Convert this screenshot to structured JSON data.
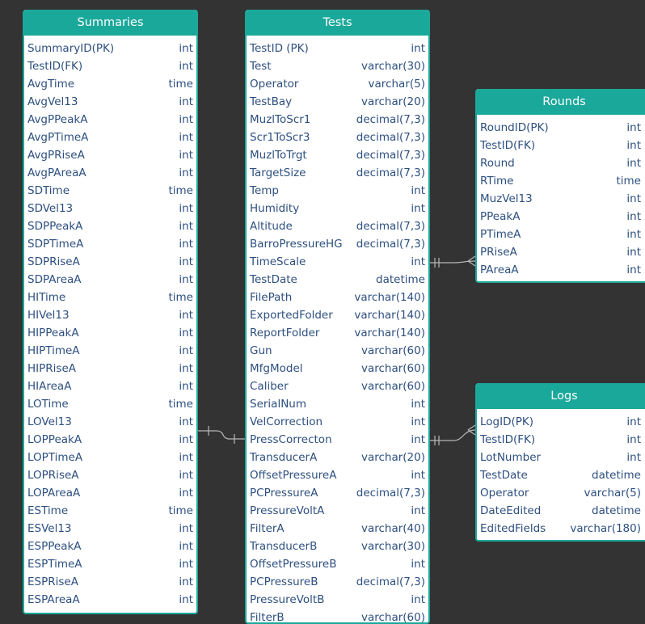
{
  "tables": {
    "summaries": {
      "title": "Summaries",
      "columns": [
        {
          "name": "SummaryID(PK)",
          "type": "int"
        },
        {
          "name": "TestID(FK)",
          "type": "int"
        },
        {
          "name": "AvgTime",
          "type": "time"
        },
        {
          "name": "AvgVel13",
          "type": "int"
        },
        {
          "name": "AvgPPeakA",
          "type": "int"
        },
        {
          "name": "AvgPTimeA",
          "type": "int"
        },
        {
          "name": "AvgPRiseA",
          "type": "int"
        },
        {
          "name": "AvgPAreaA",
          "type": "int"
        },
        {
          "name": "SDTime",
          "type": "time"
        },
        {
          "name": "SDVel13",
          "type": "int"
        },
        {
          "name": "SDPPeakA",
          "type": "int"
        },
        {
          "name": "SDPTimeA",
          "type": "int"
        },
        {
          "name": "SDPRiseA",
          "type": "int"
        },
        {
          "name": "SDPAreaA",
          "type": "int"
        },
        {
          "name": "HITime",
          "type": "time"
        },
        {
          "name": "HIVel13",
          "type": "int"
        },
        {
          "name": "HIPPeakA",
          "type": "int"
        },
        {
          "name": "HIPTimeA",
          "type": "int"
        },
        {
          "name": "HIPRiseA",
          "type": "int"
        },
        {
          "name": "HIAreaA",
          "type": "int"
        },
        {
          "name": "LOTime",
          "type": "time"
        },
        {
          "name": "LOVel13",
          "type": "int"
        },
        {
          "name": "LOPPeakA",
          "type": "int"
        },
        {
          "name": "LOPTimeA",
          "type": "int"
        },
        {
          "name": "LOPRiseA",
          "type": "int"
        },
        {
          "name": "LOPAreaA",
          "type": "int"
        },
        {
          "name": "ESTime",
          "type": "time"
        },
        {
          "name": "ESVel13",
          "type": "int"
        },
        {
          "name": "ESPPeakA",
          "type": "int"
        },
        {
          "name": "ESPTimeA",
          "type": "int"
        },
        {
          "name": "ESPRiseA",
          "type": "int"
        },
        {
          "name": "ESPAreaA",
          "type": "int"
        }
      ]
    },
    "tests": {
      "title": "Tests",
      "columns": [
        {
          "name": "TestID  (PK)",
          "type": "int"
        },
        {
          "name": "Test",
          "type": "varchar(30)"
        },
        {
          "name": "Operator",
          "type": "varchar(5)"
        },
        {
          "name": "TestBay",
          "type": "varchar(20)"
        },
        {
          "name": "MuzlToScr1",
          "type": "decimal(7,3)"
        },
        {
          "name": "Scr1ToScr3",
          "type": "decimal(7,3)"
        },
        {
          "name": "MuzlToTrgt",
          "type": "decimal(7,3)"
        },
        {
          "name": "TargetSize",
          "type": "decimal(7,3)"
        },
        {
          "name": "Temp",
          "type": "int"
        },
        {
          "name": "Humidity",
          "type": "int"
        },
        {
          "name": "Altitude",
          "type": "decimal(7,3)"
        },
        {
          "name": "BarroPressureHG",
          "type": "decimal(7,3)"
        },
        {
          "name": "TimeScale",
          "type": "int"
        },
        {
          "name": "TestDate",
          "type": "datetime"
        },
        {
          "name": "FilePath",
          "type": "varchar(140)"
        },
        {
          "name": "ExportedFolder",
          "type": "varchar(140)"
        },
        {
          "name": "ReportFolder",
          "type": "varchar(140)"
        },
        {
          "name": "Gun",
          "type": "varchar(60)"
        },
        {
          "name": "MfgModel",
          "type": "varchar(60)"
        },
        {
          "name": "Caliber",
          "type": "varchar(60)"
        },
        {
          "name": "SerialNum",
          "type": "int"
        },
        {
          "name": "VelCorrection",
          "type": "int"
        },
        {
          "name": "PressCorrecton",
          "type": "int"
        },
        {
          "name": "TransducerA",
          "type": "varchar(20)"
        },
        {
          "name": "OffsetPressureA",
          "type": "int"
        },
        {
          "name": "PCPressureA",
          "type": "decimal(7,3)"
        },
        {
          "name": "PressureVoltA",
          "type": "int"
        },
        {
          "name": "FilterA",
          "type": "varchar(40)"
        },
        {
          "name": "TransducerB",
          "type": "varchar(30)"
        },
        {
          "name": "OffsetPressureB",
          "type": "int"
        },
        {
          "name": "PCPressureB",
          "type": "decimal(7,3)"
        },
        {
          "name": "PressureVoltB",
          "type": "int"
        },
        {
          "name": "FilterB",
          "type": "varchar(60)"
        }
      ]
    },
    "rounds": {
      "title": "Rounds",
      "columns": [
        {
          "name": "RoundID(PK)",
          "type": "int"
        },
        {
          "name": "TestID(FK)",
          "type": "int"
        },
        {
          "name": "Round",
          "type": "int"
        },
        {
          "name": "RTime",
          "type": "time"
        },
        {
          "name": "MuzVel13",
          "type": "int"
        },
        {
          "name": "PPeakA",
          "type": "int"
        },
        {
          "name": "PTimeA",
          "type": "int"
        },
        {
          "name": "PRiseA",
          "type": "int"
        },
        {
          "name": "PAreaA",
          "type": "int"
        }
      ]
    },
    "logs": {
      "title": "Logs",
      "columns": [
        {
          "name": "LogID(PK)",
          "type": "int"
        },
        {
          "name": "TestID(FK)",
          "type": "int"
        },
        {
          "name": "LotNumber",
          "type": "int"
        },
        {
          "name": "TestDate",
          "type": "datetime"
        },
        {
          "name": "Operator",
          "type": "varchar(5)"
        },
        {
          "name": "DateEdited",
          "type": "datetime"
        },
        {
          "name": "EditedFields",
          "type": "varchar(180)"
        }
      ]
    }
  },
  "colors": {
    "background": "#333333",
    "header": "#1aa89a",
    "text": "#2d4f7f",
    "connector": "#b8b8b8"
  }
}
